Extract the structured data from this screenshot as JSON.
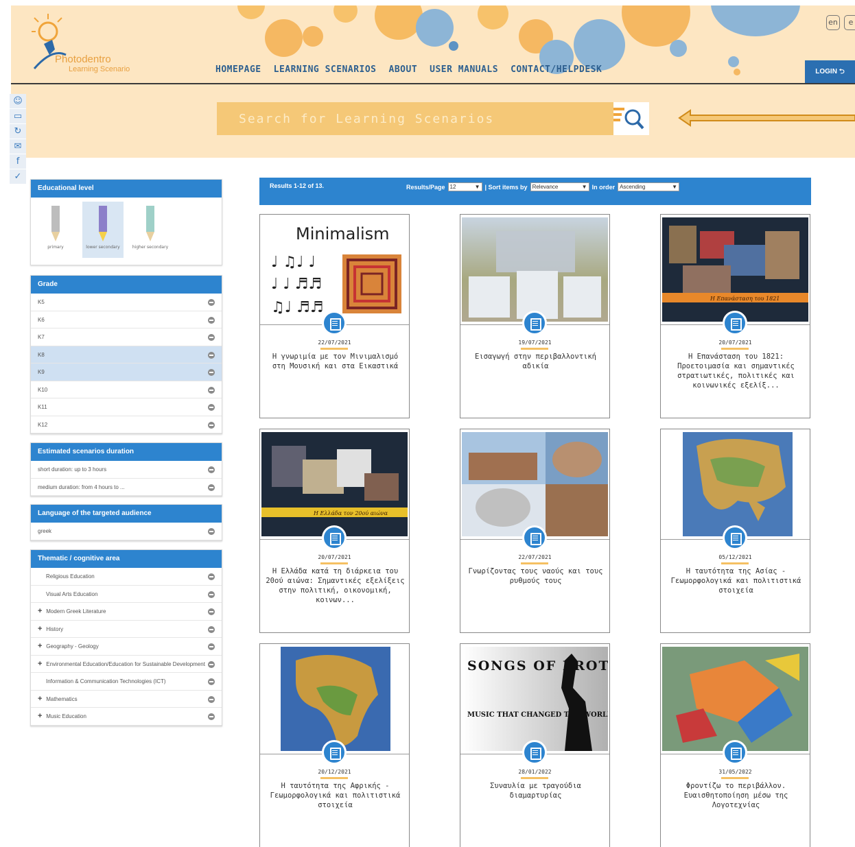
{
  "header": {
    "logo_line1": "Photodentro",
    "logo_line2": "Learning Scenario",
    "nav": [
      "HOMEPAGE",
      "LEARNING SCENARIOS",
      "ABOUT",
      "USER MANUALS",
      "CONTACT/HELPDESK"
    ],
    "lang": [
      "en",
      "e"
    ],
    "login_label": "LOGIN ⮌"
  },
  "search": {
    "placeholder": "Search for Learning Scenarios"
  },
  "social_icons": [
    "comment-icon",
    "book-icon",
    "share-icon",
    "mail-icon",
    "facebook-icon",
    "twitter-icon"
  ],
  "sidebar": {
    "educational_level": {
      "title": "Educational level",
      "items": [
        "primary",
        "lower secondary",
        "higher secondary"
      ]
    },
    "grade": {
      "title": "Grade",
      "items": [
        "K5",
        "K6",
        "K7",
        "K8",
        "K9",
        "K10",
        "K11",
        "K12"
      ]
    },
    "duration": {
      "title": "Estimated scenarios duration",
      "items": [
        "short duration: up to 3 hours",
        "medium duration: from 4 hours to ..."
      ]
    },
    "language": {
      "title": "Language of the targeted audience",
      "items": [
        "greek"
      ]
    },
    "thematic": {
      "title": "Thematic / cognitive area",
      "items": [
        "Religious Education",
        "Visual Arts Education",
        "Modern Greek Literature",
        "History",
        "Geography - Geology",
        "Environmental Education/Education for Sustainable Development",
        "Information & Communication Technologies (ICT)",
        "Mathematics",
        "Music Education"
      ]
    }
  },
  "results_bar": {
    "count": "Results 1-12 of 13.",
    "per_page_label": "Results/Page",
    "per_page_value": "12",
    "sort_label": "| Sort items by",
    "sort_value": "Relevance",
    "order_label": "In order",
    "order_value": "Ascending"
  },
  "cards": [
    {
      "date": "22/07/2021",
      "title": "Η γνωριμία με τον Μινιμαλισμό στη Μουσική και στα Εικαστικά",
      "thumb_text": "Minimalism"
    },
    {
      "date": "19/07/2021",
      "title": "Εισαγωγή στην περιβαλλοντική αδικία",
      "thumb_text": ""
    },
    {
      "date": "20/07/2021",
      "title": "Η Επανάσταση του 1821: Προετοιμασία και σημαντικές στρατιωτικές, πολιτικές και κοινωνικές εξελίξ...",
      "thumb_text": "Η Επανάσταση του 1821"
    },
    {
      "date": "20/07/2021",
      "title": "Η Ελλάδα κατά τη διάρκεια του 20ού αιώνα: Σημαντικές εξελίξεις στην πολιτική, οικονομική, κοινων...",
      "thumb_text": "Η Ελλάδα τον 20ού αιώνα"
    },
    {
      "date": "22/07/2021",
      "title": "Γνωρίζοντας τους ναούς και τους ρυθμούς τους",
      "thumb_text": ""
    },
    {
      "date": "05/12/2021",
      "title": "Η ταυτότητα της Ασίας - Γεωμορφολογικά και πολιτιστικά στοιχεία",
      "thumb_text": ""
    },
    {
      "date": "20/12/2021",
      "title": "Η ταυτότητα της Αφρικής - Γεωμορφολογικά και πολιτιστικά στοιχεία",
      "thumb_text": ""
    },
    {
      "date": "28/01/2022",
      "title": "Συναυλία με τραγούδια διαμαρτυρίας",
      "thumb_text": "SONGS OF PROTEST",
      "thumb_sub": "MUSIC THAT CHANGED THE WORLD"
    },
    {
      "date": "31/05/2022",
      "title": "Φροντίζω το περιβάλλον. Ευαισθητοποίηση μέσω της Λογοτεχνίας",
      "thumb_text": ""
    }
  ],
  "colors": {
    "accent": "#2d84cf",
    "header_bg": "#fde6c2",
    "search_bg": "#f5c877",
    "underline": "#f5c062"
  }
}
